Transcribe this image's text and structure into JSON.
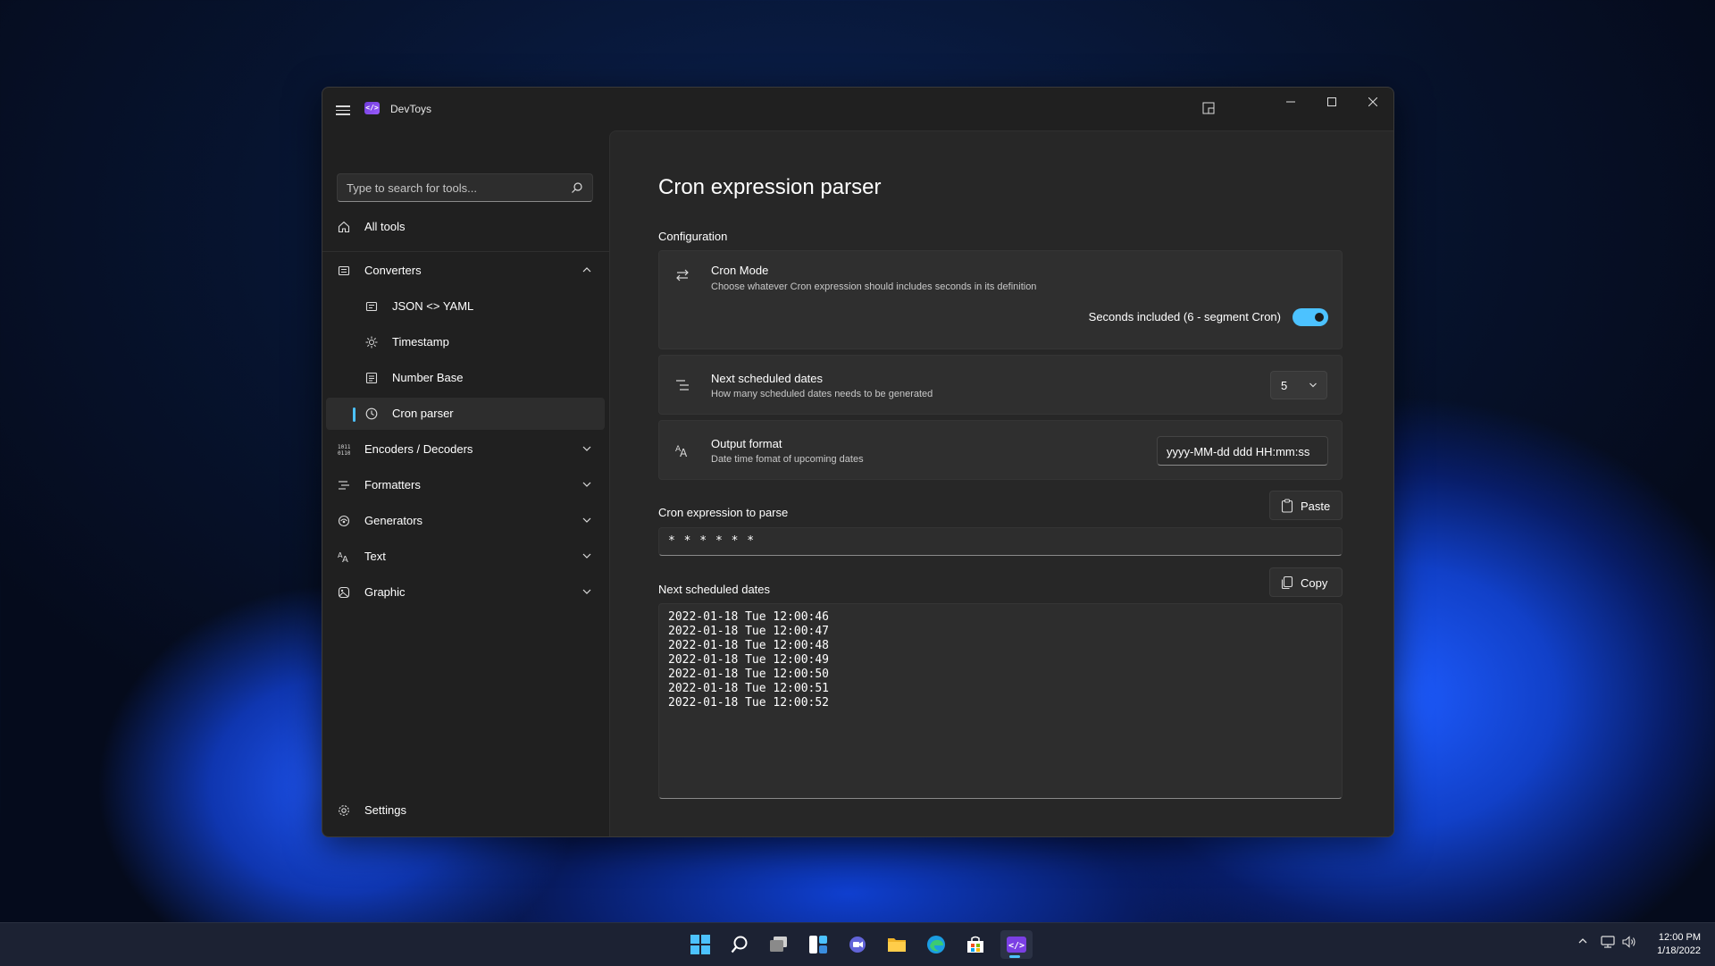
{
  "app": {
    "title": "DevToys"
  },
  "search": {
    "placeholder": "Type to search for tools..."
  },
  "nav": {
    "all_tools": "All tools",
    "converters": "Converters",
    "json_yaml": "JSON <> YAML",
    "timestamp": "Timestamp",
    "number_base": "Number Base",
    "cron_parser": "Cron parser",
    "encoders": "Encoders / Decoders",
    "formatters": "Formatters",
    "generators": "Generators",
    "text": "Text",
    "graphic": "Graphic",
    "settings": "Settings"
  },
  "page": {
    "title": "Cron expression parser",
    "configuration_label": "Configuration",
    "cron_mode_title": "Cron Mode",
    "cron_mode_desc": "Choose whatever Cron expression should includes seconds in its definition",
    "seconds_toggle_label": "Seconds included (6 - segment Cron)",
    "seconds_toggle_on": true,
    "next_dates_title": "Next scheduled dates",
    "next_dates_desc": "How many scheduled dates needs to be generated",
    "next_dates_count": "5",
    "output_format_title": "Output format",
    "output_format_desc": "Date time fomat of upcoming dates",
    "output_format_value": "yyyy-MM-dd ddd HH:mm:ss",
    "cron_input_label": "Cron expression to parse",
    "paste_label": "Paste",
    "cron_expression": "* * * * * *",
    "results_label": "Next scheduled dates",
    "copy_label": "Copy",
    "results": [
      "2022-01-18 Tue 12:00:46",
      "2022-01-18 Tue 12:00:47",
      "2022-01-18 Tue 12:00:48",
      "2022-01-18 Tue 12:00:49",
      "2022-01-18 Tue 12:00:50",
      "2022-01-18 Tue 12:00:51",
      "2022-01-18 Tue 12:00:52"
    ]
  },
  "taskbar": {
    "time": "12:00 PM",
    "date": "1/18/2022"
  },
  "colors": {
    "accent": "#4cc2ff",
    "window_bg": "#202020",
    "content_bg": "#272727",
    "card_bg": "#2f2f2f"
  }
}
